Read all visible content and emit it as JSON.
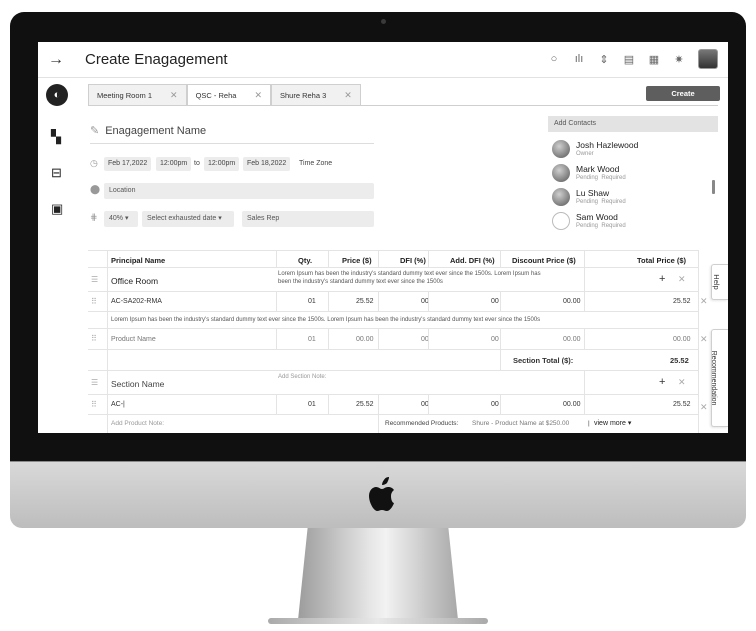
{
  "app": {
    "title": "Create Enagagement"
  },
  "topbar_icons": [
    "search-icon",
    "analytics-icon",
    "sort-icon",
    "notification-icon",
    "grid-icon",
    "theme-icon",
    "user-avatar"
  ],
  "rail_icons": [
    "brand-logo",
    "dashboard-icon",
    "layout-icon",
    "contact-card-icon"
  ],
  "tabs": [
    {
      "label": "Meeting Room 1",
      "active": false
    },
    {
      "label": "QSC - Reha",
      "active": true
    },
    {
      "label": "Shure Reha 3",
      "active": false
    }
  ],
  "create_label": "Create",
  "engagement": {
    "name_placeholder": "Enagagement Name",
    "start_date": "Feb 17,2022",
    "start_time": "12:00pm",
    "to": "to",
    "end_time": "12:00pm",
    "end_date": "Feb 18,2022",
    "timezone": "Time Zone",
    "location_placeholder": "Location",
    "percent": "40%",
    "exhausted_date": "Select exhausted date",
    "sales_rep": "Sales Rep"
  },
  "contacts": {
    "header": "Add Contacts",
    "items": [
      {
        "name": "Josh Hazlewood",
        "status": "Owner",
        "required": ""
      },
      {
        "name": "Mark Wood",
        "status": "Pending",
        "required": "Required"
      },
      {
        "name": "Lu Shaw",
        "status": "Pending",
        "required": "Required"
      },
      {
        "name": "Sam Wood",
        "status": "Pending",
        "required": "Required"
      }
    ]
  },
  "table": {
    "headers": {
      "principal": "Principal Name",
      "qty": "Qty.",
      "price": "Price ($)",
      "dfi": "DFI (%)",
      "add_dfi": "Add. DFI (%)",
      "discount": "Discount Price ($)",
      "total": "Total Price ($)"
    },
    "section1": {
      "name": "Office Room",
      "note": "Lorem Ipsum has been the industry's standard dummy text ever since the 1500s. Lorem Ipsum has",
      "note2": "been the industry's standard dummy text ever since the 1500s",
      "row1": {
        "product": "AC-SA202-RMA",
        "qty": "01",
        "price": "25.52",
        "dfi": "00",
        "add_dfi": "00",
        "discount": "00.00",
        "total": "25.52"
      },
      "row1_note": "Lorem Ipsum has been the industry's standard dummy text ever since the 1500s. Lorem Ipsum has been the industry's standard dummy text ever since the 1500s",
      "row2": {
        "product": "Product Name",
        "qty": "01",
        "price": "00.00",
        "dfi": "00",
        "add_dfi": "00",
        "discount": "00.00",
        "total": "00.00"
      },
      "total_label": "Section Total  ($):",
      "total_value": "25.52"
    },
    "section2": {
      "name_placeholder": "Section Name",
      "note_placeholder": "Add Section Note:",
      "row1": {
        "product": "AC-|",
        "qty": "01",
        "price": "25.52",
        "dfi": "00",
        "add_dfi": "00",
        "discount": "00.00",
        "total": "25.52"
      },
      "product_note_placeholder": "Add Product Note:",
      "recommended_label": "Recommended Products:",
      "recommended_value": "Shure - Product Name at $250.00",
      "separator": "|",
      "view_more": "view more"
    }
  },
  "side_tabs": {
    "help": "Help",
    "recommendation": "Recommendation"
  }
}
